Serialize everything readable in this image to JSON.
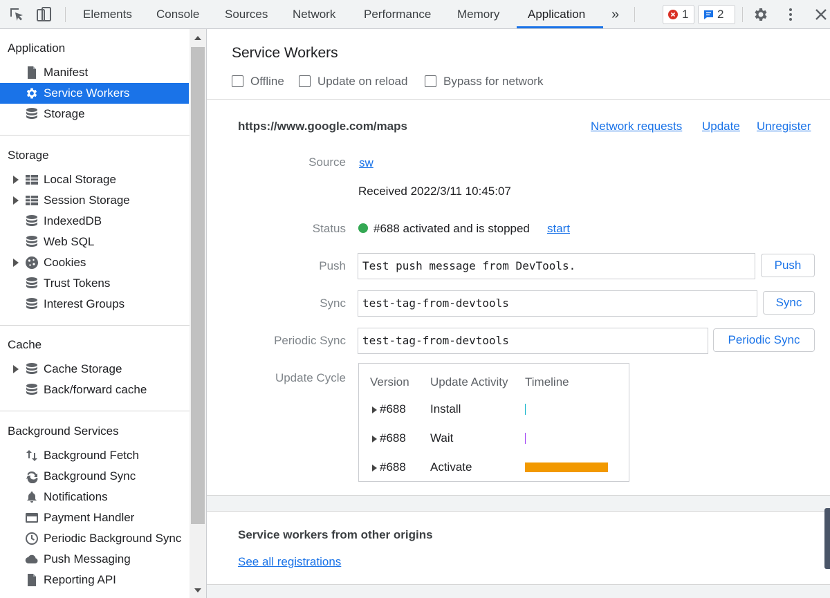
{
  "toolbar": {
    "tabs": [
      "Elements",
      "Console",
      "Sources",
      "Network",
      "Performance",
      "Memory",
      "Application"
    ],
    "active_tab": "Application",
    "errors_count": "1",
    "messages_count": "2",
    "more_tabs_glyph": "»"
  },
  "sidebar": {
    "application": {
      "title": "Application",
      "items": [
        "Manifest",
        "Service Workers",
        "Storage"
      ],
      "selected": "Service Workers"
    },
    "storage": {
      "title": "Storage",
      "items": [
        "Local Storage",
        "Session Storage",
        "IndexedDB",
        "Web SQL",
        "Cookies",
        "Trust Tokens",
        "Interest Groups"
      ]
    },
    "cache": {
      "title": "Cache",
      "items": [
        "Cache Storage",
        "Back/forward cache"
      ]
    },
    "background": {
      "title": "Background Services",
      "items": [
        "Background Fetch",
        "Background Sync",
        "Notifications",
        "Payment Handler",
        "Periodic Background Sync",
        "Push Messaging",
        "Reporting API"
      ]
    }
  },
  "main": {
    "title": "Service Workers",
    "options": [
      "Offline",
      "Update on reload",
      "Bypass for network"
    ],
    "origin": "https://www.google.com/maps",
    "actions": [
      "Network requests",
      "Update",
      "Unregister"
    ],
    "source_label": "Source",
    "source_link": "sw",
    "received": "Received 2022/3/11 10:45:07",
    "status_label": "Status",
    "status_text": "#688 activated and is stopped",
    "status_link": "start",
    "status_color": "#34a853",
    "push_label": "Push",
    "push_value": "Test push message from DevTools.",
    "push_button": "Push",
    "sync_label": "Sync",
    "sync_value": "test-tag-from-devtools",
    "sync_button": "Sync",
    "periodic_label": "Periodic Sync",
    "periodic_value": "test-tag-from-devtools",
    "periodic_button": "Periodic Sync",
    "cycle_label": "Update Cycle",
    "cycle": {
      "headers": [
        "Version",
        "Update Activity",
        "Timeline"
      ],
      "rows": [
        {
          "version": "#688",
          "activity": "Install"
        },
        {
          "version": "#688",
          "activity": "Wait"
        },
        {
          "version": "#688",
          "activity": "Activate"
        }
      ],
      "activate_color": "#f29900"
    },
    "other_origins_title": "Service workers from other origins",
    "see_all_link": "See all registrations"
  }
}
